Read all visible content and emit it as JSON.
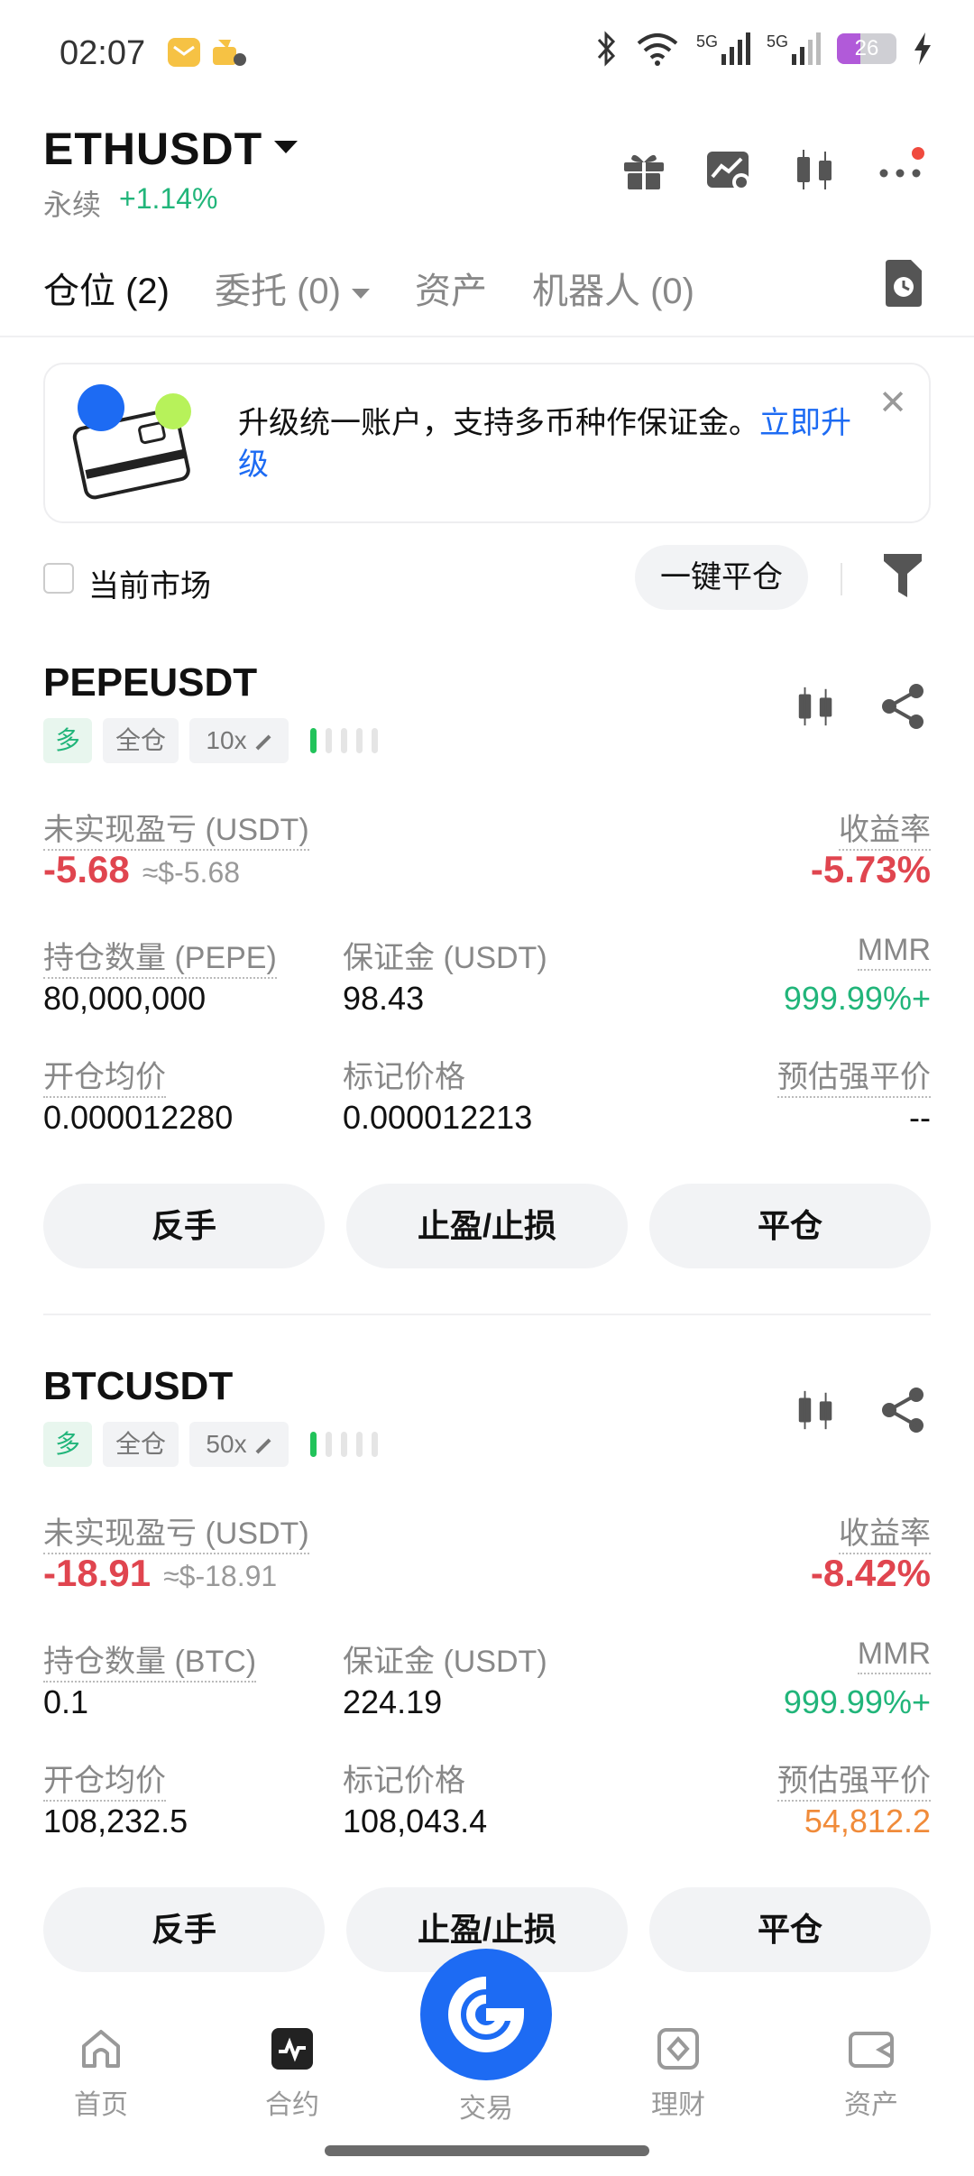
{
  "status_bar": {
    "time": "02:07",
    "net1": "5G",
    "net2": "5G",
    "battery": "26"
  },
  "header": {
    "pair": "ETHUSDT",
    "type": "永续",
    "change": "+1.14%"
  },
  "tabs": [
    {
      "label": "仓位 (2)"
    },
    {
      "label": "委托 (0)"
    },
    {
      "label": "资产"
    },
    {
      "label": "机器人 (0)"
    }
  ],
  "banner": {
    "text": "升级统一账户，支持多币种作保证金。",
    "link": "立即升级"
  },
  "filter": {
    "current_market": "当前市场",
    "close_all": "一键平仓"
  },
  "positions": [
    {
      "symbol": "PEPEUSDT",
      "side": "多",
      "margin_mode": "全仓",
      "leverage": "10x",
      "pnl_label": "未实现盈亏 (USDT)",
      "pnl": "-5.68",
      "pnl_approx": "≈$-5.68",
      "roe_label": "收益率",
      "roe": "-5.73%",
      "size_label": "持仓数量 (PEPE)",
      "size": "80,000,000",
      "margin_label": "保证金 (USDT)",
      "margin": "98.43",
      "mmr_label": "MMR",
      "mmr": "999.99%+",
      "entry_label": "开仓均价",
      "entry": "0.000012280",
      "mark_label": "标记价格",
      "mark": "0.000012213",
      "liq_label": "预估强平价",
      "liq": "--",
      "btn_reverse": "反手",
      "btn_tpsl": "止盈/止损",
      "btn_close": "平仓"
    },
    {
      "symbol": "BTCUSDT",
      "side": "多",
      "margin_mode": "全仓",
      "leverage": "50x",
      "pnl_label": "未实现盈亏 (USDT)",
      "pnl": "-18.91",
      "pnl_approx": "≈$-18.91",
      "roe_label": "收益率",
      "roe": "-8.42%",
      "size_label": "持仓数量 (BTC)",
      "size": "0.1",
      "margin_label": "保证金 (USDT)",
      "margin": "224.19",
      "mmr_label": "MMR",
      "mmr": "999.99%+",
      "entry_label": "开仓均价",
      "entry": "108,232.5",
      "mark_label": "标记价格",
      "mark": "108,043.4",
      "liq_label": "预估强平价",
      "liq": "54,812.2",
      "btn_reverse": "反手",
      "btn_tpsl": "止盈/止损",
      "btn_close": "平仓"
    }
  ],
  "nav": [
    {
      "label": "首页",
      "icon": "home-icon"
    },
    {
      "label": "合约",
      "icon": "futures-icon"
    },
    {
      "label": "交易",
      "icon": "trade-icon"
    },
    {
      "label": "理财",
      "icon": "earn-icon"
    },
    {
      "label": "资产",
      "icon": "wallet-icon"
    }
  ],
  "colors": {
    "accent": "#1d6bf3",
    "up": "#21b57a",
    "down": "#e0454f",
    "warning": "#f08b3a"
  }
}
